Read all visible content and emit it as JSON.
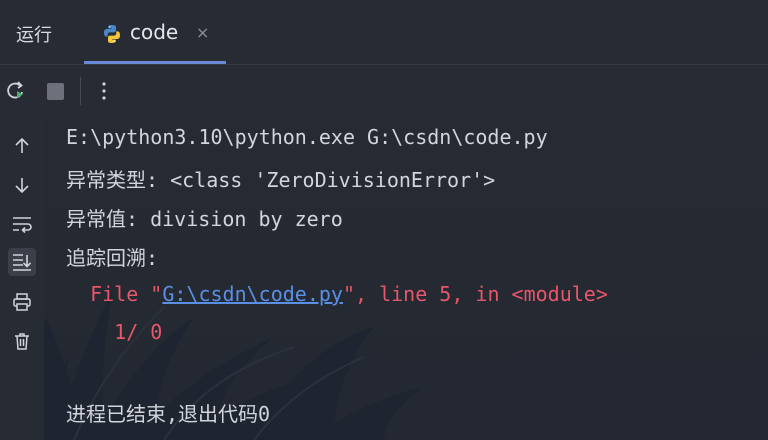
{
  "tabbar": {
    "run_label": "运行",
    "tab_title": "code",
    "close_glyph": "×"
  },
  "toolbar": {
    "rerun_icon": "rerun-icon",
    "stop_icon": "stop-icon",
    "more_icon": "more-vertical-icon"
  },
  "gutter": {
    "icons": [
      "arrow-up-icon",
      "arrow-down-icon",
      "soft-wrap-icon",
      "scroll-to-end-icon",
      "print-icon",
      "trash-icon"
    ]
  },
  "console": {
    "cmd": "E:\\python3.10\\python.exe G:\\csdn\\code.py",
    "exc_type": "异常类型: <class 'ZeroDivisionError'>",
    "exc_value": "异常值: division by zero",
    "traceback": "追踪回溯:",
    "file_prefix": "  File \"",
    "file_link": "G:\\csdn\\code.py",
    "file_suffix": "\", line 5, in <module>",
    "code_line": "    1/ 0",
    "exit": "进程已结束,退出代码0"
  },
  "colors": {
    "error": "#e8566a",
    "link": "#5a8fe6",
    "accent": "#6b8ad6"
  }
}
